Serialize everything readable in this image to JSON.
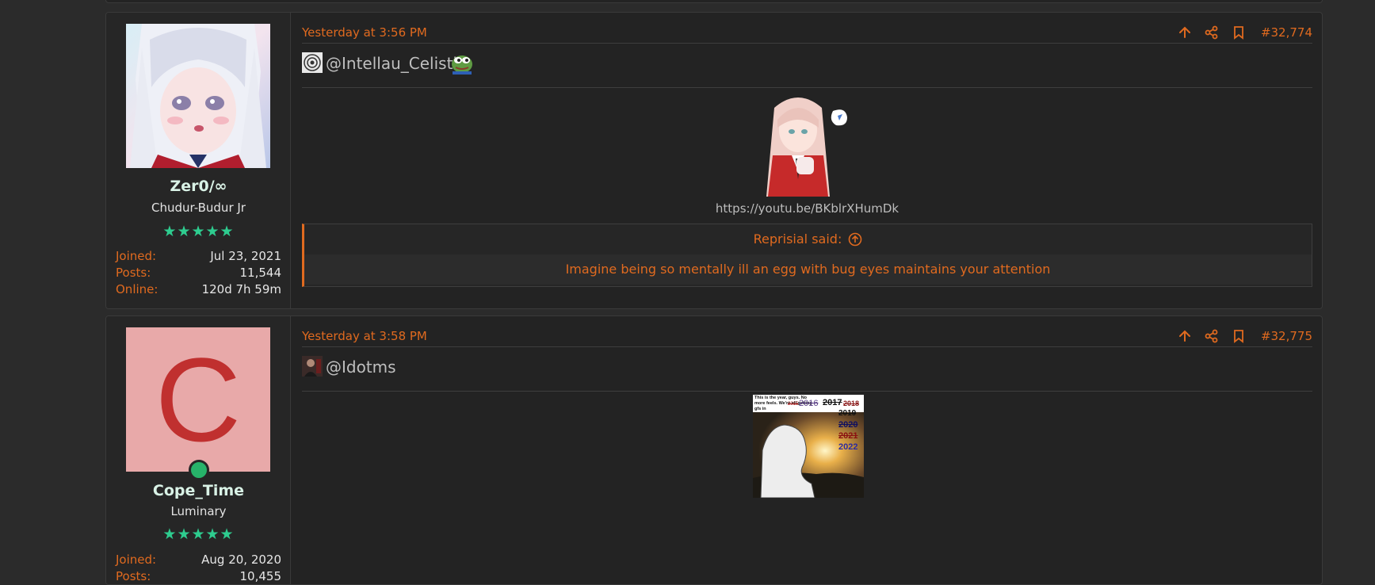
{
  "posts": [
    {
      "username": "Zer0/∞",
      "user_title": "Chudur-Budur Jr",
      "stars": "★★★★★",
      "stats": [
        {
          "label": "Joined:",
          "value": "Jul 23, 2021"
        },
        {
          "label": "Posts:",
          "value": "11,544"
        },
        {
          "label": "Online:",
          "value": "120d 7h 59m"
        }
      ],
      "date": "Yesterday at 3:56 PM",
      "post_number": "#32,774",
      "mention": "@Intellau_Celistic",
      "link": "https://youtu.be/BKblrXHumDk",
      "quote_author": "Reprisial said:",
      "quote_text": "Imagine being so mentally ill an egg with bug eyes maintains your attention"
    },
    {
      "username": "Cope_Time",
      "user_title": "Luminary",
      "stars": "★★★★★",
      "avatar_letter": "C",
      "stats": [
        {
          "label": "Joined:",
          "value": "Aug 20, 2020"
        },
        {
          "label": "Posts:",
          "value": "10,455"
        }
      ],
      "date": "Yesterday at 3:58 PM",
      "post_number": "#32,775",
      "mention": "@Idotms",
      "meme_text": "This is the year, guys. No more feels. We're all getting gfs in",
      "meme_years": [
        "2015",
        "2016",
        "2017",
        "2018",
        "2019",
        "2020",
        "2021",
        "2022"
      ]
    }
  ],
  "colors": {
    "accent": "#e06a1f",
    "stars": "#2ecc8f",
    "online": "#27b36a",
    "avatar_letter_bg": "#e8a9a9",
    "avatar_letter_fg": "#c0302f"
  },
  "icons": [
    "arrow-up-icon",
    "share-icon",
    "bookmark-icon",
    "arrow-circle-up-icon"
  ]
}
